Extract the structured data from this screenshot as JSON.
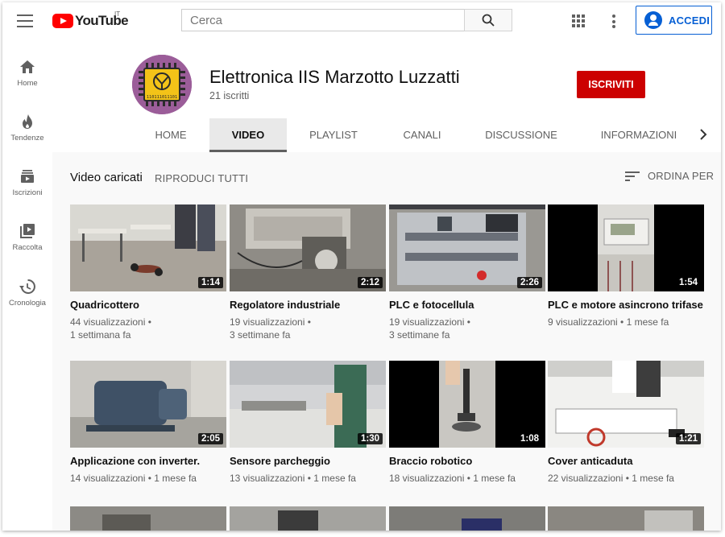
{
  "topbar": {
    "logo_text": "YouTube",
    "country_code": "IT",
    "search_placeholder": "Cerca",
    "signin_label": "ACCEDI"
  },
  "sidebar": {
    "items": [
      {
        "label": "Home",
        "icon": "home-icon"
      },
      {
        "label": "Tendenze",
        "icon": "trending-icon"
      },
      {
        "label": "Iscrizioni",
        "icon": "subscriptions-icon"
      },
      {
        "label": "Raccolta",
        "icon": "library-icon"
      },
      {
        "label": "Cronologia",
        "icon": "history-icon"
      }
    ]
  },
  "channel": {
    "name": "Elettronica IIS Marzotto Luzzatti",
    "subscribers": "21 iscritti",
    "subscribe_label": "ISCRIVITI",
    "avatar_text": "110111011101",
    "tabs": [
      "HOME",
      "VIDEO",
      "PLAYLIST",
      "CANALI",
      "DISCUSSIONE",
      "INFORMAZIONI"
    ],
    "active_tab": "VIDEO"
  },
  "videos_section": {
    "title": "Video caricati",
    "play_all_label": "RIPRODUCI TUTTI",
    "sort_label": "ORDINA PER"
  },
  "videos": [
    {
      "title": "Quadricottero",
      "duration": "1:14",
      "views": "44 visualizzazioni",
      "age": "1 settimana fa"
    },
    {
      "title": "Regolatore industriale",
      "duration": "2:12",
      "views": "19 visualizzazioni",
      "age": "3 settimane fa"
    },
    {
      "title": "PLC e fotocellula",
      "duration": "2:26",
      "views": "19 visualizzazioni",
      "age": "3 settimane fa"
    },
    {
      "title": "PLC e motore asincrono trifase",
      "duration": "1:54",
      "views": "9 visualizzazioni",
      "age": "1 mese fa"
    },
    {
      "title": "Applicazione con inverter.",
      "duration": "2:05",
      "views": "14 visualizzazioni",
      "age": "1 mese fa"
    },
    {
      "title": "Sensore parcheggio",
      "duration": "1:30",
      "views": "13 visualizzazioni",
      "age": "1 mese fa"
    },
    {
      "title": "Braccio robotico",
      "duration": "1:08",
      "views": "18 visualizzazioni",
      "age": "1 mese fa"
    },
    {
      "title": "Cover anticaduta",
      "duration": "1:21",
      "views": "22 visualizzazioni",
      "age": "1 mese fa"
    }
  ],
  "colors": {
    "brand_red": "#ff0000",
    "subscribe_red": "#cc0000",
    "signin_blue": "#065fd4",
    "avatar_purple": "#9b5d99"
  }
}
